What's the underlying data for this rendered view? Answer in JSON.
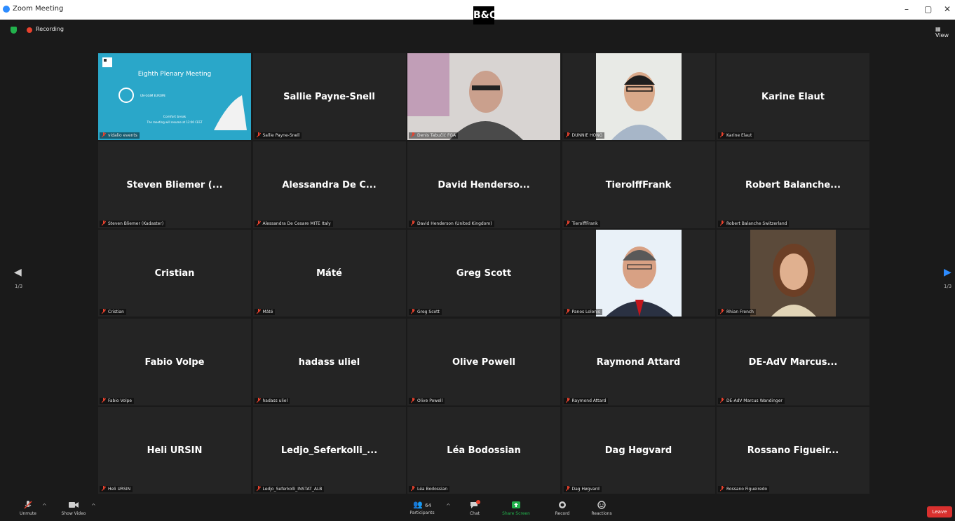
{
  "window": {
    "title": "Zoom Meeting",
    "minimize": "–",
    "maximize": "▢",
    "close": "✕"
  },
  "status": {
    "recording": "Recording",
    "view": "View"
  },
  "pagination": {
    "left_page": "1/3",
    "right_page": "1/3"
  },
  "tiles": [
    {
      "display": "",
      "tag": "vidalio events",
      "video": true,
      "kind": "slide",
      "slide": {
        "title": "Eighth Plenary Meeting",
        "org": "UN-GGIM EUROPE",
        "line1": "Comfort break",
        "line2": "The meeting will resume at 12:00 CEST"
      }
    },
    {
      "display": "Sallie Payne-Snell",
      "tag": "Sallie Payne-Snell"
    },
    {
      "display": "",
      "tag": "Denis Tabučić FGA",
      "video": true,
      "kind": "person1"
    },
    {
      "display": "",
      "tag": "DUNNIE HONG",
      "video": true,
      "kind": "person2"
    },
    {
      "display": "Karine Elaut",
      "tag": "Karine Elaut"
    },
    {
      "display": "Steven Bliemer (...",
      "tag": "Steven Bliemer (Kadaster)"
    },
    {
      "display": "Alessandra De C...",
      "tag": "Alessandra De Cesare MITE Italy"
    },
    {
      "display": "David Henderso...",
      "tag": "David Henderson (United Kingdom)"
    },
    {
      "display": "TierolffFrank",
      "tag": "TierolffFrank"
    },
    {
      "display": "Robert Balanche...",
      "tag": "Robert Balanche Switzerland"
    },
    {
      "display": "Cristian",
      "tag": "Cristian"
    },
    {
      "display": "Máté",
      "tag": "Máté"
    },
    {
      "display": "Greg Scott",
      "tag": "Greg Scott"
    },
    {
      "display": "",
      "tag": "Panos Lolonis",
      "video": true,
      "kind": "person3"
    },
    {
      "display": "",
      "tag": "Rhian French",
      "video": true,
      "kind": "person4"
    },
    {
      "display": "Fabio Volpe",
      "tag": "Fabio Volpe"
    },
    {
      "display": "hadass uliel",
      "tag": "hadass uliel"
    },
    {
      "display": "Olive Powell",
      "tag": "Olive Powell"
    },
    {
      "display": "Raymond Attard",
      "tag": "Raymond Attard"
    },
    {
      "display": "DE-AdV Marcus...",
      "tag": "DE-AdV Marcus Wandinger"
    },
    {
      "display": "Heli URSIN",
      "tag": "Heli URSIN"
    },
    {
      "display": "Ledjo_Seferkolli_...",
      "tag": "Ledjo_Seferkolli_INSTAT_ALB"
    },
    {
      "display": "Léa Bodossian",
      "tag": "Léa Bodossian"
    },
    {
      "display": "Dag Høgvard",
      "tag": "Dag Høgvard"
    },
    {
      "display": "Rossano Figueir...",
      "tag": "Rossano Figueiredo"
    }
  ],
  "toolbar": {
    "unmute": "Unmute",
    "video": "Show Video",
    "participants": "Participants",
    "participants_count": "64",
    "chat": "Chat",
    "share": "Share Screen",
    "record": "Record",
    "reactions": "Reactions",
    "leave": "Leave"
  },
  "colors": {
    "accent": "#2d8cff",
    "share_green": "#22b14c",
    "leave_red": "#d9302e",
    "selected_outline": "#e2e400"
  }
}
